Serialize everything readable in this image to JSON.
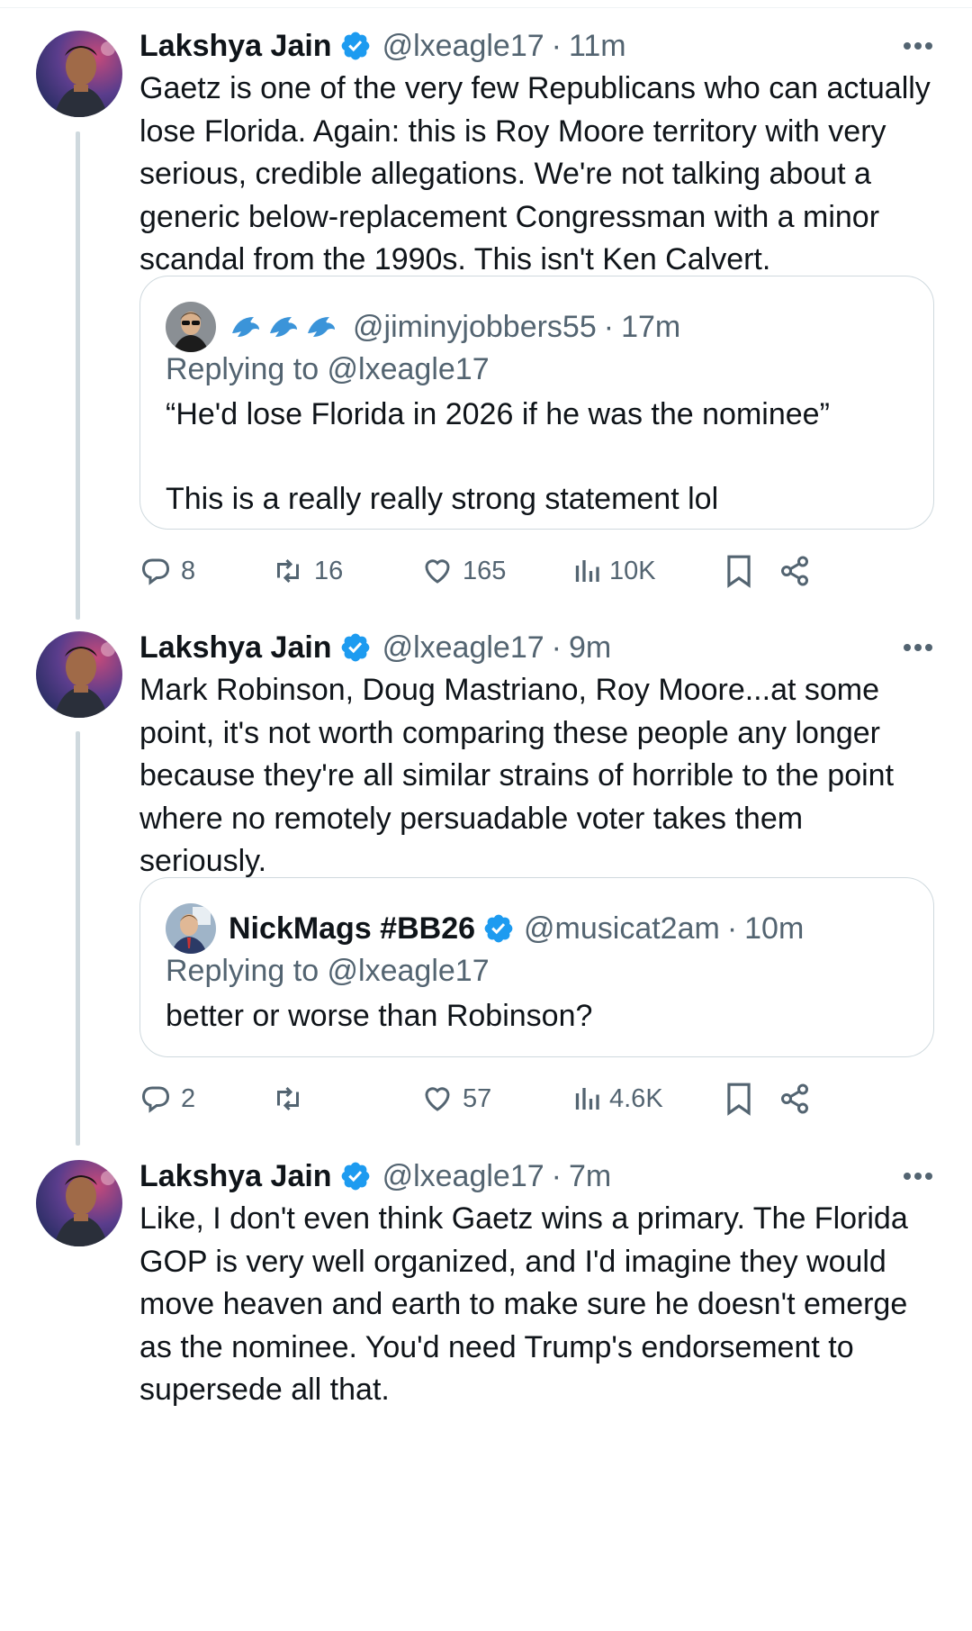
{
  "colors": {
    "text_primary": "#0f1419",
    "text_secondary": "#536471",
    "verified_blue": "#1d9bf0",
    "border": "#cfd9de"
  },
  "tweets": [
    {
      "name": "Lakshya Jain",
      "handle": "@lxeagle17",
      "dot": "·",
      "time": "11m",
      "text": "Gaetz is one of the very few Republicans who can actually lose Florida. Again: this is Roy Moore territory with very serious, credible allegations. We're not talking about a generic below-replacement Congressman with a minor scandal from the 1990s. This isn't Ken Calvert.",
      "quote": {
        "name": "",
        "name_icons": [
          "dolphin-emoji",
          "dolphin-emoji",
          "dolphin-emoji"
        ],
        "handle": "@jiminyjobbers55",
        "dot": "·",
        "time": "17m",
        "replying_to": "Replying to @lxeagle17",
        "text": "“He'd lose Florida in 2026 if he was the nominee”\n\nThis is a really really strong statement lol"
      },
      "stats": {
        "replies": "8",
        "reposts": "16",
        "likes": "165",
        "views": "10K"
      }
    },
    {
      "name": "Lakshya Jain",
      "handle": "@lxeagle17",
      "dot": "·",
      "time": "9m",
      "text": "Mark Robinson, Doug Mastriano, Roy Moore...at some point, it's not worth comparing these people any longer because they're all similar strains of horrible to the point where no remotely persuadable voter takes them seriously.",
      "quote": {
        "name": "NickMags #BB26",
        "handle": "@musicat2am",
        "dot": "·",
        "time": "10m",
        "replying_to": "Replying to @lxeagle17",
        "text": "better or worse than Robinson?"
      },
      "stats": {
        "replies": "2",
        "reposts": "",
        "likes": "57",
        "views": "4.6K"
      }
    },
    {
      "name": "Lakshya Jain",
      "handle": "@lxeagle17",
      "dot": "·",
      "time": "7m",
      "text": "Like, I don't even think Gaetz wins a primary. The Florida GOP is very well organized, and I'd imagine they would move heaven and earth to make sure he doesn't emerge as the nominee. You'd need Trump's endorsement to supersede all that."
    }
  ]
}
